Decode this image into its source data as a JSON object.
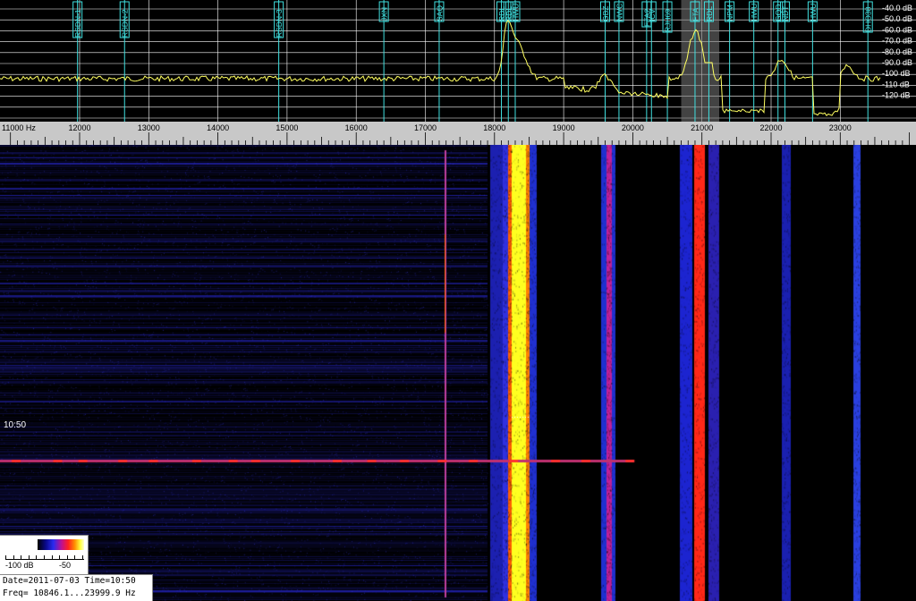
{
  "spectrum": {
    "db_labels": [
      "-40.0 dB",
      "-50.0 dB",
      "-60.0 dB",
      "-70.0 dB",
      "-80.0 dB",
      "-90.0 dB",
      "-100 dB",
      "-110 dB",
      "-120 dB"
    ],
    "stations": [
      {
        "label": "RSDN-1",
        "freq": 11970
      },
      {
        "label": "RSDN-2",
        "freq": 12650
      },
      {
        "label": "RSDN-3",
        "freq": 14880
      },
      {
        "label": "JXN",
        "freq": 16400
      },
      {
        "label": "SAQ",
        "freq": 17200
      },
      {
        "label": "RDL",
        "freq": 18100
      },
      {
        "label": "RDL",
        "freq": 18200
      },
      {
        "label": "HWU",
        "freq": 18300
      },
      {
        "label": "GBZ",
        "freq": 19600
      },
      {
        "label": "NWC",
        "freq": 19800
      },
      {
        "label": "ICV",
        "freq": 20270
      },
      {
        "label": "FTA2",
        "freq": 20200
      },
      {
        "label": "RJH69",
        "freq": 20500
      },
      {
        "label": "FTA",
        "freq": 20900
      },
      {
        "label": "RDL",
        "freq": 21100
      },
      {
        "label": "NPM",
        "freq": 21400
      },
      {
        "label": "HWU",
        "freq": 21750
      },
      {
        "label": "GQD",
        "freq": 22100
      },
      {
        "label": "NDT",
        "freq": 22200
      },
      {
        "label": "HWU",
        "freq": 22600
      },
      {
        "label": "DHO38",
        "freq": 23400
      }
    ]
  },
  "ruler": {
    "start_label": "11000 Hz",
    "tick_labels": [
      "12000",
      "13000",
      "14000",
      "15000",
      "16000",
      "17000",
      "18000",
      "19000",
      "20000",
      "21000",
      "22000",
      "23000"
    ]
  },
  "waterfall": {
    "time_marker": "10:50"
  },
  "colorbar": {
    "min_label": "-100 dB",
    "max_label": "-50"
  },
  "status": {
    "line1": "Date=2011-07-03 Time=10:50",
    "line2": "Freq= 10846.1...23999.9 Hz"
  },
  "colors": {
    "trace": "#ffff60",
    "marker": "#40e0e0",
    "grid": "#ffffff"
  }
}
